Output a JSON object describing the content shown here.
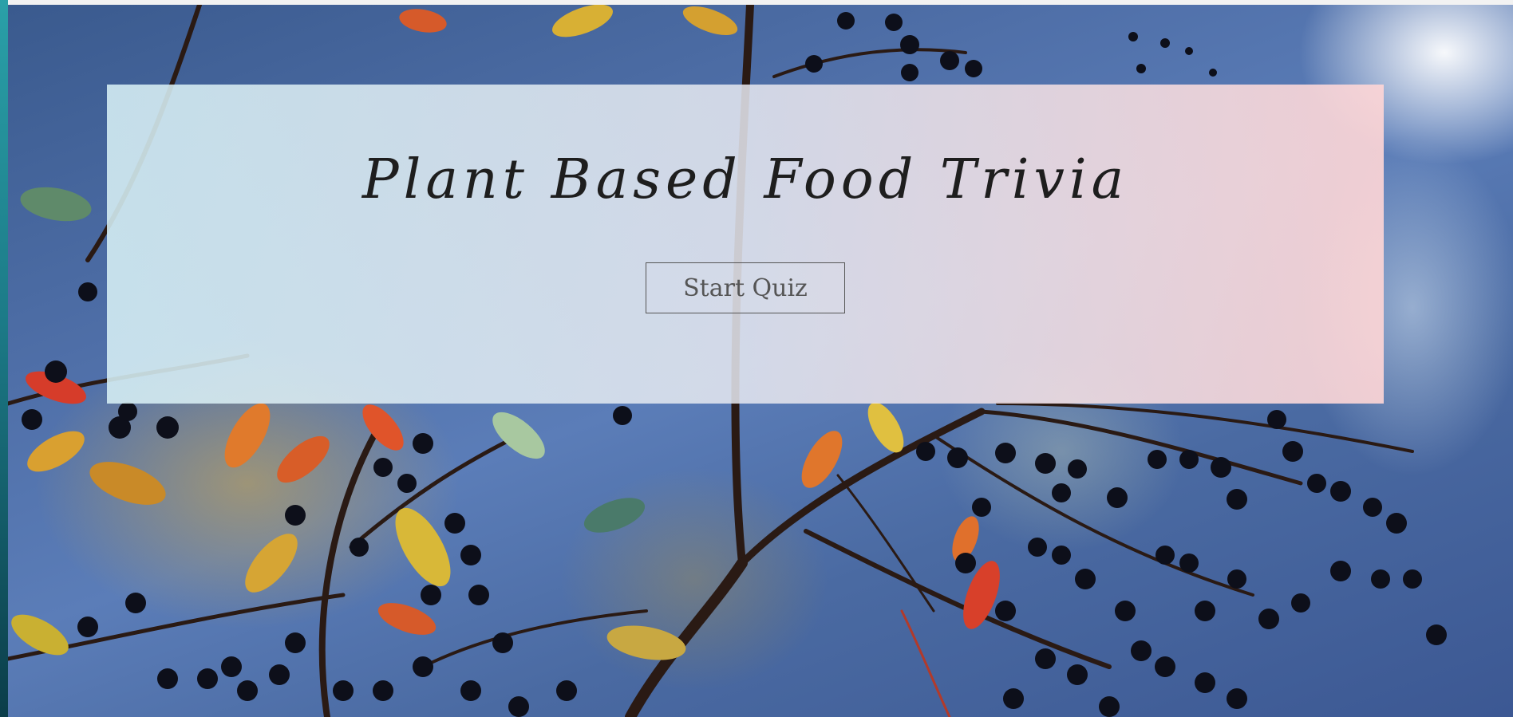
{
  "hero": {
    "title": "Plant Based Food Trivia",
    "start_button_label": "Start Quiz"
  },
  "background": {
    "description_icon": "berry-branch-photo"
  },
  "colors": {
    "title_text": "#1e1e1e",
    "button_text": "#555555",
    "button_border": "#555555",
    "panel_gradient_left": "#d7f0f5",
    "panel_gradient_right": "#ffd6d6",
    "sky_blue": "#4f6fa8"
  }
}
